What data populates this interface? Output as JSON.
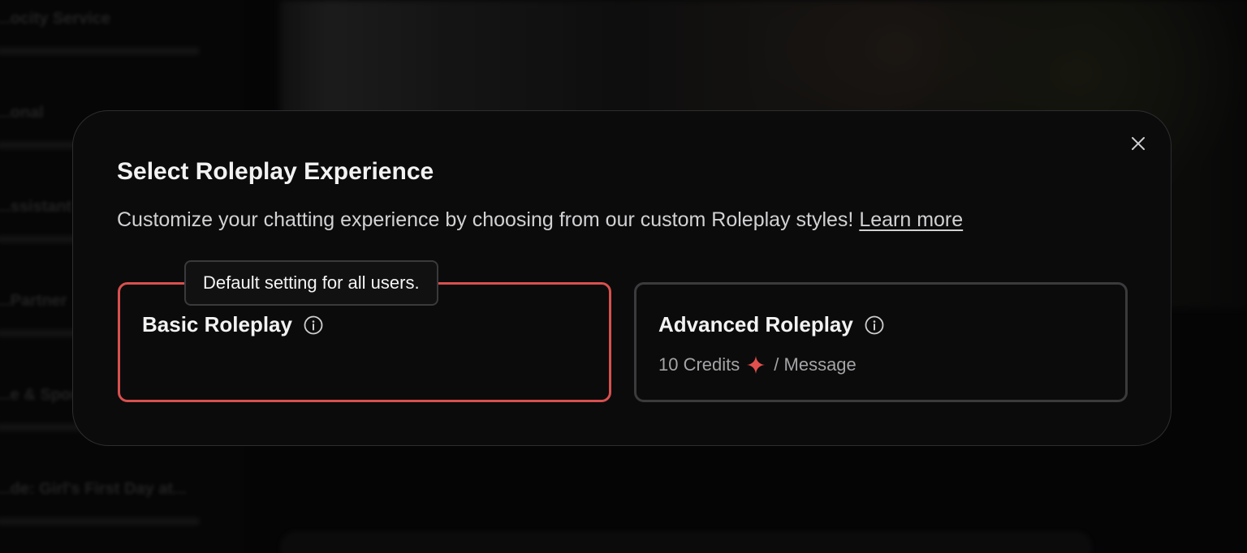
{
  "background": {
    "sidebar_items": [
      {
        "title": "...ocity Service"
      },
      {
        "title": "...onal"
      },
      {
        "title": "...ssistant G"
      },
      {
        "title": "...Partner"
      },
      {
        "title": "...e & Sport"
      },
      {
        "title": "...de: Girl's First Day at..."
      }
    ]
  },
  "modal": {
    "title": "Select Roleplay Experience",
    "description": "Customize your chatting experience by choosing from our custom Roleplay styles! ",
    "learn_more": "Learn more",
    "close_icon": "close-icon",
    "options": [
      {
        "title": "Basic Roleplay",
        "icon": "info-icon",
        "selected": true,
        "tooltip": "Default setting for all users."
      },
      {
        "title": "Advanced Roleplay",
        "icon": "info-icon",
        "selected": false,
        "cost_amount": "10 Credits",
        "cost_icon": "sparkle-icon",
        "cost_unit": "/ Message"
      }
    ]
  },
  "colors": {
    "accent": "#d9504e",
    "modal_bg": "#0b0b0c",
    "text_primary": "#f2f2f2",
    "text_secondary": "#a4a4a6",
    "card_border_unselected": "#3b3b3d"
  }
}
